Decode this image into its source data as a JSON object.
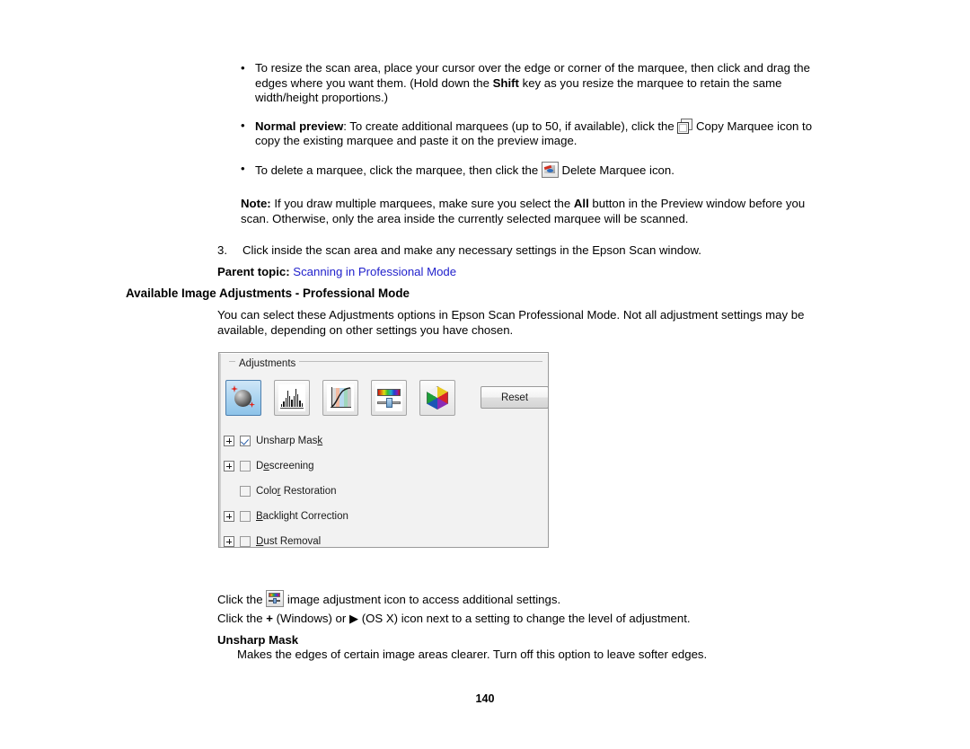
{
  "page": {
    "number": "140"
  },
  "bullets": [
    {
      "marker": "•",
      "part1": "To resize the scan area, place your cursor over the edge or corner of the marquee, then click and drag the edges where you want them. (Hold down the ",
      "bold1": "Shift",
      "part2": " key as you resize the marquee to retain the same width/height proportions.)"
    },
    {
      "marker": "•",
      "bold1": "Normal preview",
      "part1": ": To create additional marquees (up to 50, if available), click the ",
      "icon": "copy-marquee-icon",
      "part2": " Copy Marquee icon to copy the existing marquee and paste it on the preview image."
    },
    {
      "marker": "•",
      "part1": "To delete a marquee, click the marquee, then click the ",
      "icon": "delete-marquee-icon",
      "part2": " Delete Marquee icon."
    }
  ],
  "note": {
    "label": "Note:",
    "part1": " If you draw multiple marquees, make sure you select the ",
    "bold1": "All",
    "part2": " button in the Preview window before you scan. Otherwise, only the area inside the currently selected marquee will be scanned."
  },
  "step": {
    "number": "3.",
    "text": "Click inside the scan area and make any necessary settings in the Epson Scan window."
  },
  "parent_topic": {
    "label": "Parent topic:",
    "link": "Scanning in Professional Mode",
    "link_color": "#2222cc"
  },
  "section_heading": "Available Image Adjustments - Professional Mode",
  "intro_paragraph": "You can select these Adjustments options in Epson Scan Professional Mode. Not all adjustment settings may be available, depending on other settings you have chosen.",
  "adjustments_panel": {
    "group_title": "Adjustments",
    "reset_label": "Reset",
    "toolbar": [
      {
        "name": "auto-exposure-icon",
        "selected": true
      },
      {
        "name": "histogram-adjustment-icon",
        "selected": false
      },
      {
        "name": "tone-correction-icon",
        "selected": false
      },
      {
        "name": "image-adjustment-icon",
        "selected": false
      },
      {
        "name": "color-palette-icon",
        "selected": false
      }
    ],
    "options": [
      {
        "label": "Unsharp Mask",
        "pre": "Unsharp Mas",
        "accel": "k",
        "post": "",
        "checked": true,
        "has_plus": true
      },
      {
        "label": "Descreening",
        "pre": "D",
        "accel": "e",
        "post": "screening",
        "checked": false,
        "has_plus": true
      },
      {
        "label": "Color Restoration",
        "pre": "Colo",
        "accel": "r",
        "post": " Restoration",
        "checked": false,
        "has_plus": false
      },
      {
        "label": "Backlight Correction",
        "pre": "",
        "accel": "B",
        "post": "acklight Correction",
        "checked": false,
        "has_plus": true
      },
      {
        "label": "Dust Removal",
        "pre": "",
        "accel": "D",
        "post": "ust Removal",
        "checked": false,
        "has_plus": true
      }
    ]
  },
  "after_panel": {
    "line1_a": "Click the ",
    "line1_icon": "image-adjustment-icon",
    "line1_b": " image adjustment icon to access additional settings.",
    "line2_a": "Click the ",
    "line2_plus": "+",
    "line2_b": " (Windows) or ",
    "line2_arrow": "▶",
    "line2_c": " (OS X) icon next to a setting to change the level of adjustment.",
    "sub_heading": "Unsharp Mask",
    "sub_paragraph": "Makes the edges of certain image areas clearer. Turn off this option to leave softer edges."
  }
}
